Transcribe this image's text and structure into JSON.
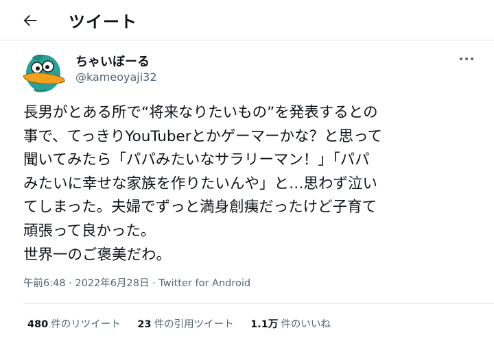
{
  "header": {
    "back_icon": "arrow-left-icon",
    "title": "ツイート"
  },
  "tweet": {
    "author": {
      "display_name": "ちゃいぼーる",
      "handle": "@kameoyaji32",
      "avatar_icon": "platypus-avatar"
    },
    "more_icon": "ellipsis-icon",
    "text": "長男がとある所で“将来なりたいもの”を発表するとの\n事で、てっきりYouTuberとかゲーマーかな？と思って\n聞いてみたら「パパみたいなサラリーマン！」「パパ\nみたいに幸せな家族を作りたいんや」と…思わず泣い\nてしまった。夫婦でずっと満身創痍だったけど子育て\n頑張って良かった。\n世界一のご褒美だわ。",
    "time": "午前6:48",
    "separator1": "·",
    "date": "2022年6月28日",
    "separator2": "·",
    "client": "Twitter for Android"
  },
  "stats": {
    "retweets": {
      "count": "480",
      "label": "件のリツイート"
    },
    "quotes": {
      "count": "23",
      "label": "件の引用ツイート"
    },
    "likes": {
      "count": "1.1万",
      "label": "件のいいね"
    }
  },
  "colors": {
    "text": "#0f1419",
    "secondary": "#536471",
    "divider": "#e3e6e8",
    "avatar_green": "#2aa198",
    "avatar_bill": "#f4a01c"
  }
}
